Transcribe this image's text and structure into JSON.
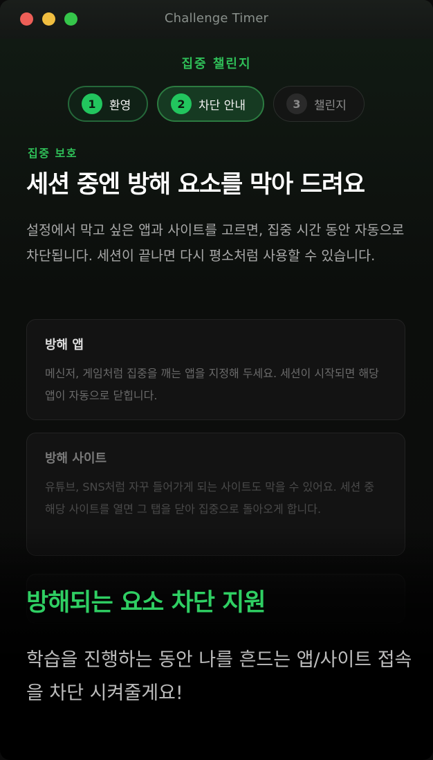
{
  "window": {
    "title": "Challenge Timer"
  },
  "header": {
    "label": "집중 챌린지"
  },
  "steps": [
    {
      "number": "1",
      "label": "환영",
      "state": "done"
    },
    {
      "number": "2",
      "label": "차단 안내",
      "state": "active"
    },
    {
      "number": "3",
      "label": "챌린지",
      "state": "pending"
    }
  ],
  "section": {
    "eyebrow": "집중 보호",
    "headline": "세션 중엔 방해 요소를 막아 드려요",
    "description": "설정에서 막고 싶은 앱과 사이트를 고르면, 집중 시간 동안 자동으로 차단됩니다. 세션이 끝나면 다시 평소처럼 사용할 수 있습니다."
  },
  "cards": [
    {
      "title": "방해 앱",
      "body": "메신저, 게임처럼 집중을 깨는 앱을 지정해 두세요. 세션이 시작되면 해당 앱이 자동으로 닫힙니다."
    },
    {
      "title": "방해 사이트",
      "body": "유튜브, SNS처럼 자꾸 들어가게 되는 사이트도 막을 수 있어요. 세션 중 해당 사이트를 열면 그 탭을 닫아 집중으로 돌아오게 합니다."
    }
  ],
  "overlay": {
    "title": "방해되는 요소 차단 지원",
    "text": "학습을 진행하는 동안 나를 흔드는 앱/사이트 접속을 차단 시켜줄게요!"
  },
  "colors": {
    "accent": "#22c55e",
    "background": "#0f0f0f"
  }
}
